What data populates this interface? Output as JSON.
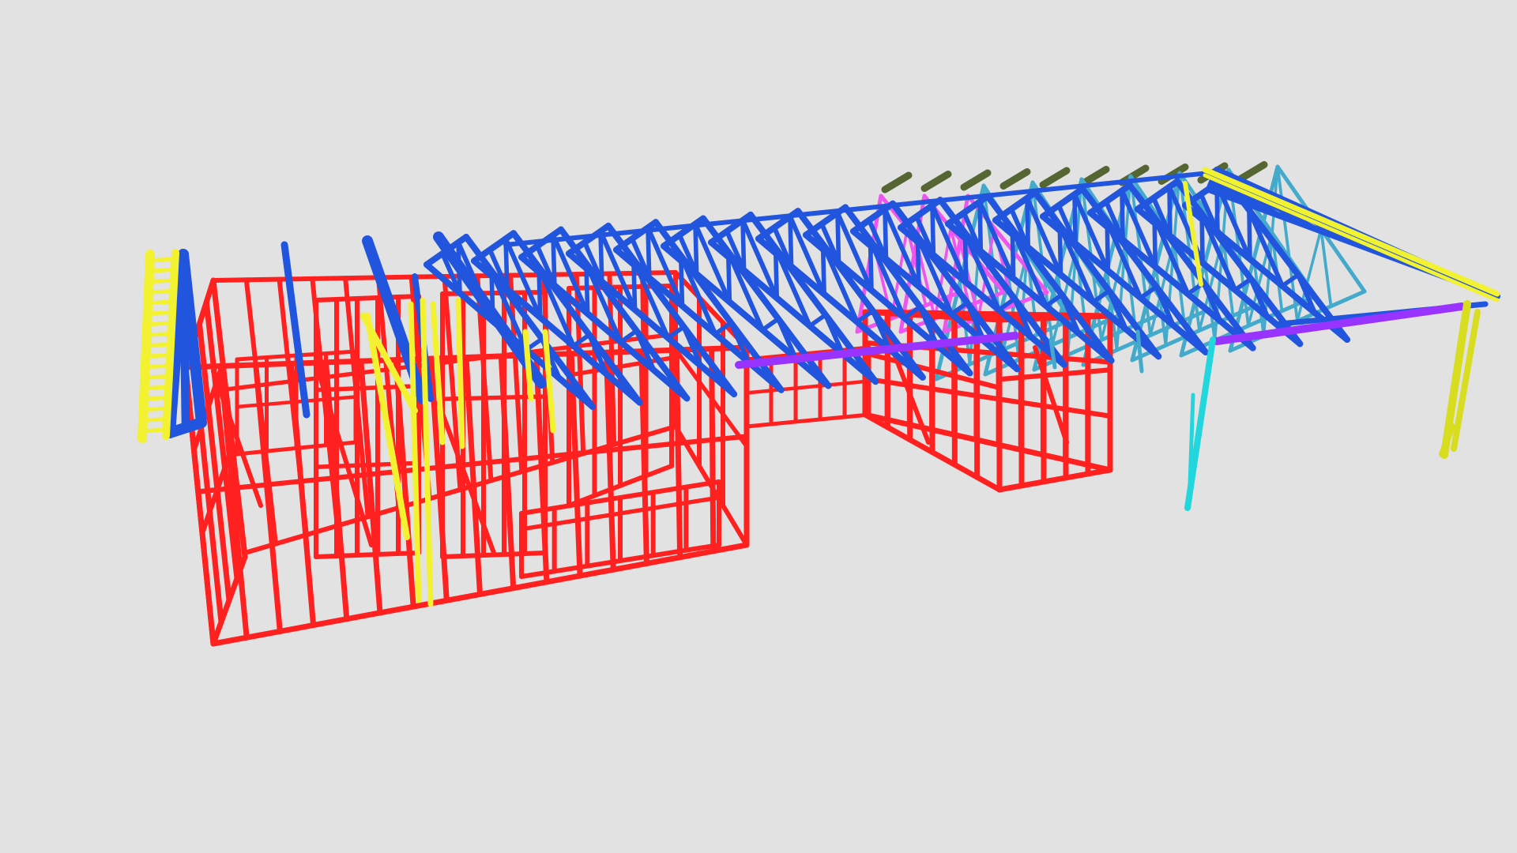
{
  "scene": {
    "subject": "steel-frame-building-model",
    "background_color": "#e2e2e2",
    "materials": {
      "wall_frame": "#ff2020",
      "roof_truss": "#2255dd",
      "end_ladder": "#f2f230",
      "jamb_stud": "#f2f230",
      "lintel_beam": "#9933ff",
      "post_cyan": "#22d6dd",
      "post_yellow": "#d8dd20",
      "truss_pink": "#ee55ee",
      "truss_teal": "#44aacc",
      "truss_olive": "#556633"
    }
  }
}
